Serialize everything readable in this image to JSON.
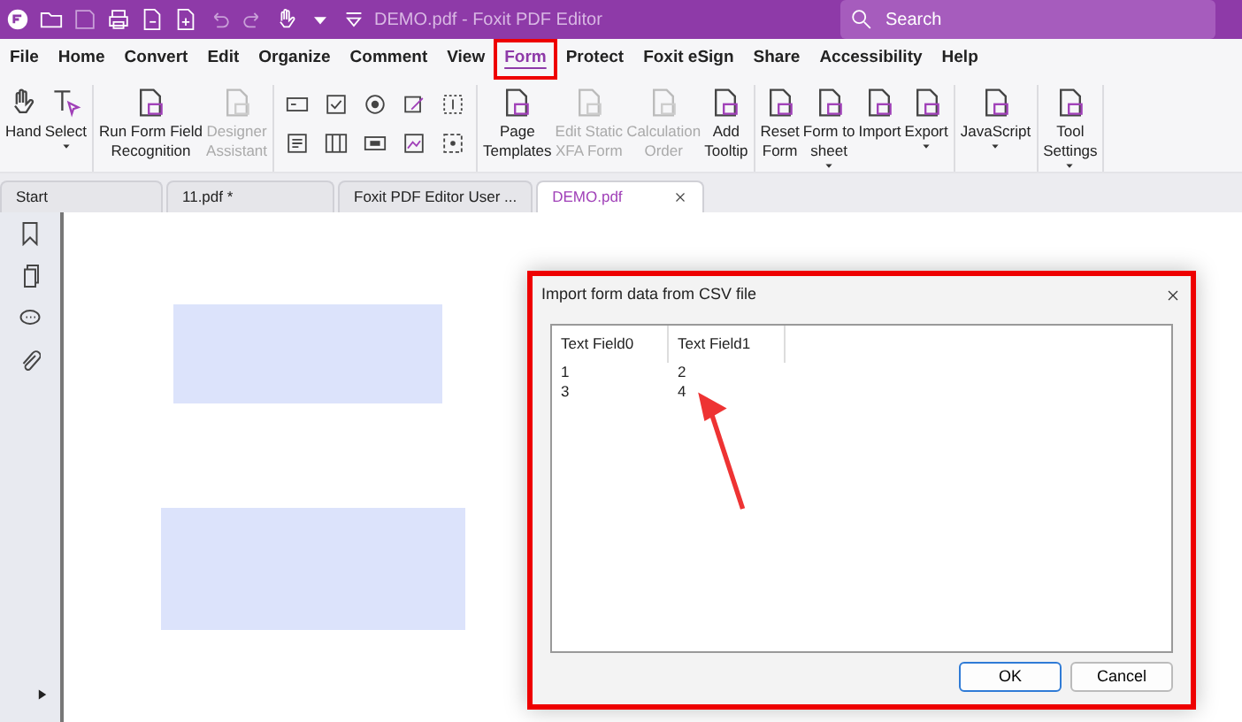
{
  "window": {
    "title": "DEMO.pdf - Foxit PDF Editor",
    "search": {
      "placeholder": "Search"
    }
  },
  "menu": [
    {
      "label": "File",
      "selected": false
    },
    {
      "label": "Home",
      "selected": false
    },
    {
      "label": "Convert",
      "selected": false
    },
    {
      "label": "Edit",
      "selected": false
    },
    {
      "label": "Organize",
      "selected": false
    },
    {
      "label": "Comment",
      "selected": false
    },
    {
      "label": "View",
      "selected": false
    },
    {
      "label": "Form",
      "selected": true
    },
    {
      "label": "Protect",
      "selected": false
    },
    {
      "label": "Foxit eSign",
      "selected": false
    },
    {
      "label": "Share",
      "selected": false
    },
    {
      "label": "Accessibility",
      "selected": false
    },
    {
      "label": "Help",
      "selected": false
    }
  ],
  "ribbon": [
    {
      "kind": "buttons",
      "items": [
        {
          "label": "Hand",
          "disabled": false,
          "dropdown": false
        },
        {
          "label": "Select",
          "disabled": false,
          "dropdown": true
        }
      ]
    },
    {
      "kind": "buttons",
      "items": [
        {
          "label": "Run Form Field\nRecognition",
          "disabled": false,
          "dropdown": false
        },
        {
          "label": "Designer\nAssistant",
          "disabled": true,
          "dropdown": false
        }
      ]
    },
    {
      "kind": "field-tools"
    },
    {
      "kind": "buttons",
      "items": [
        {
          "label": "Page\nTemplates",
          "disabled": false,
          "dropdown": false
        },
        {
          "label": "Edit Static\nXFA Form",
          "disabled": true,
          "dropdown": false
        },
        {
          "label": "Calculation\nOrder",
          "disabled": true,
          "dropdown": false
        },
        {
          "label": "Add\nTooltip",
          "disabled": false,
          "dropdown": false
        }
      ]
    },
    {
      "kind": "buttons",
      "items": [
        {
          "label": "Reset\nForm",
          "disabled": false,
          "dropdown": false
        },
        {
          "label": "Form to\nsheet",
          "disabled": false,
          "dropdown": true
        },
        {
          "label": "Import",
          "disabled": false,
          "dropdown": false
        },
        {
          "label": "Export",
          "disabled": false,
          "dropdown": true
        }
      ]
    },
    {
      "kind": "buttons",
      "items": [
        {
          "label": "JavaScript",
          "disabled": false,
          "dropdown": true
        }
      ]
    },
    {
      "kind": "buttons",
      "items": [
        {
          "label": "Tool\nSettings",
          "disabled": false,
          "dropdown": true
        }
      ]
    }
  ],
  "doc_tabs": [
    {
      "label": "Start",
      "selected": false
    },
    {
      "label": "11.pdf *",
      "selected": false
    },
    {
      "label": "Foxit PDF Editor User ...",
      "selected": false
    },
    {
      "label": "DEMO.pdf",
      "selected": true
    }
  ],
  "dialog": {
    "title": "Import form data from CSV file",
    "columns": [
      "Text Field0",
      "Text Field1"
    ],
    "rows": [
      [
        "1",
        "2"
      ],
      [
        "3",
        "4"
      ]
    ],
    "buttons": [
      {
        "label": "OK",
        "default": true
      },
      {
        "label": "Cancel",
        "default": false
      }
    ]
  }
}
